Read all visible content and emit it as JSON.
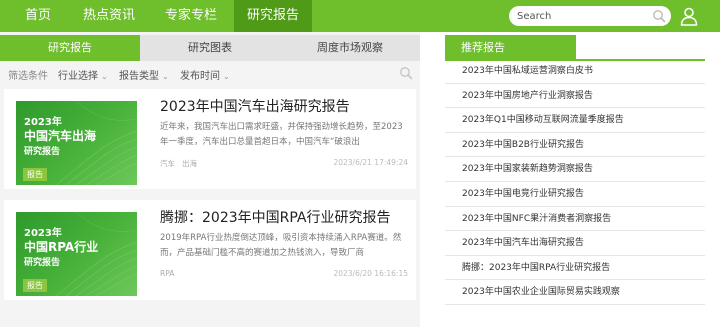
{
  "nav": {
    "items": [
      "首页",
      "热点资讯",
      "专家专栏",
      "研究报告"
    ],
    "active_index": 3,
    "search_placeholder": "Search",
    "search_icon": "search-icon",
    "user_icon": "user-icon"
  },
  "tabs": [
    "研究报告",
    "研究图表",
    "周度市场观察"
  ],
  "filters": {
    "label": "筛选条件",
    "options": [
      "行业选择",
      "报告类型",
      "发布时间"
    ]
  },
  "reports": [
    {
      "thumb_year": "2023年",
      "thumb_title": "中国汽车出海",
      "thumb_sub": "研究报告",
      "thumb_badge": "报告",
      "title": "2023年中国汽车出海研究报告",
      "desc": "近年来，我国汽车出口需求旺盛，并保持强劲增长趋势，至2023年一季度，汽车出口总量首超日本，中国汽车“破浪出",
      "tags": [
        "汽车",
        "出海"
      ],
      "date": "2023/6/21 17:49:24"
    },
    {
      "thumb_year": "2023年",
      "thumb_title": "中国RPA行业",
      "thumb_sub": "研究报告",
      "thumb_badge": "报告",
      "title": "腾挪：2023年中国RPA行业研究报告",
      "desc": "2019年RPA行业热度倒达顶峰，吸引资本持续涌入RPA赛道。然而，产品基础门槛不高的赛道加之热钱流入，导致厂商",
      "tags": [
        "RPA"
      ],
      "date": "2023/6/20 16:16:15"
    }
  ],
  "recommend": {
    "title": "推荐报告",
    "items": [
      "2023年中国私域运营洞察白皮书",
      "2023年中国房地产行业洞察报告",
      "2023年Q1中国移动互联网流量季度报告",
      "2023年中国B2B行业研究报告",
      "2023年中国家装新趋势洞察报告",
      "2023年中国电竞行业研究报告",
      "2023年中国NFC果汁消费者洞察报告",
      "2023年中国汽车出海研究报告",
      "腾挪：2023年中国RPA行业研究报告",
      "2023年中国农业企业国际贸易实践观察"
    ]
  },
  "colors": {
    "brand": "#6fbe2c",
    "brand_dark": "#4f9a17",
    "thumb": "#3aa534"
  }
}
